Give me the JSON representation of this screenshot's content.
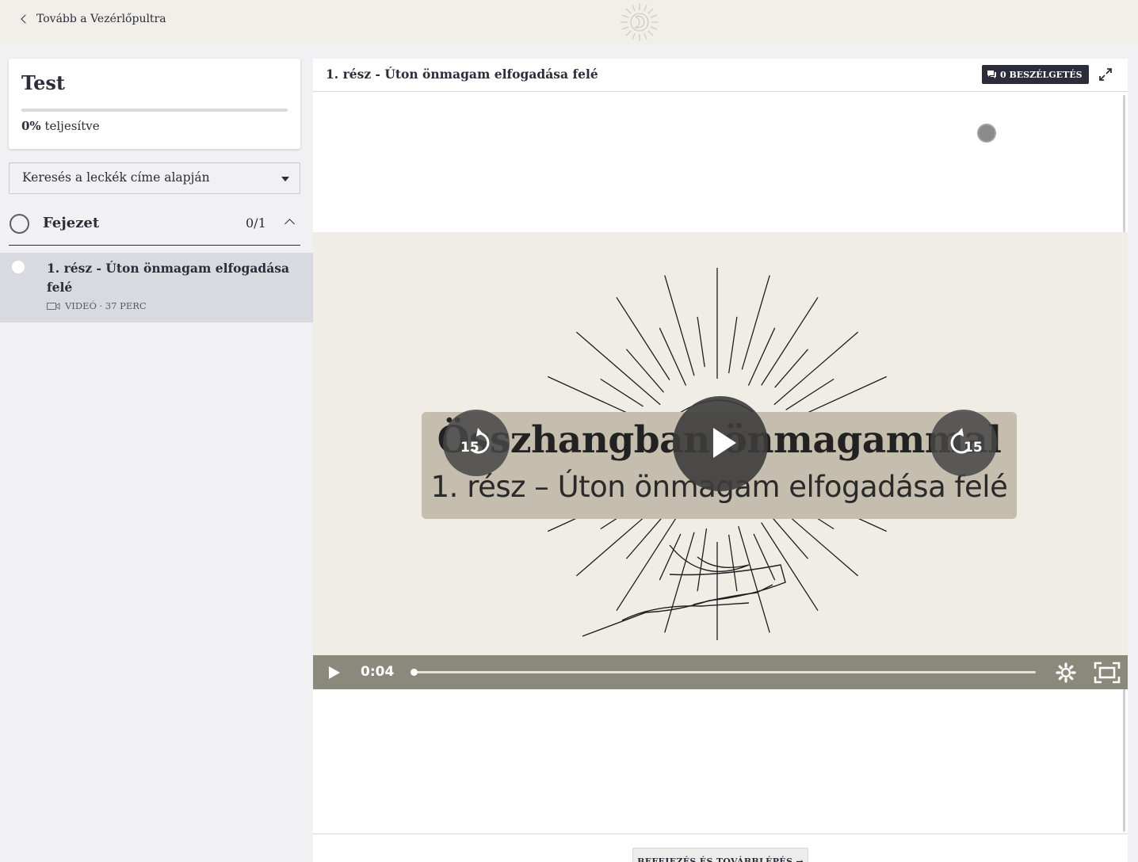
{
  "topbar": {
    "back_label": "Tovább a Vezérlőpultra",
    "logo_icon": "sun-moon-logo-icon"
  },
  "sidebar": {
    "course_title": "Test",
    "progress_percent": "0%",
    "progress_value": 0,
    "progress_suffix": "teljesítve",
    "search_placeholder": "Keresés a leckék címe alapján",
    "chapter": {
      "title": "Fejezet",
      "count": "0/1"
    },
    "lessons": [
      {
        "title": "1. rész - Úton önmagam elfogadása felé",
        "meta": "VIDEÓ · 37 PERC",
        "icon": "video-camera-icon"
      }
    ]
  },
  "content": {
    "lesson_heading": "1. rész - Úton önmagam elfogadása felé",
    "comments_label": "0 BESZÉLGETÉS",
    "video": {
      "title_text": "Összhangban önmagammal",
      "subtitle_text": "1. rész – Úton önmagam elfogadása felé",
      "skip_back": "15",
      "skip_forward": "15",
      "current_time": "0:04",
      "progress": 0.002
    },
    "finish_label": "BEFEJEZÉS ÉS TOVÁBBLÉPÉS →"
  },
  "colors": {
    "topbar_bg": "#f1efe9",
    "sidebar_bg": "#f1f1f3",
    "active_lesson_bg": "#d9dadf",
    "dark_text": "#2c2c3a",
    "video_bg": "#f0ede7",
    "video_band": "#c5bdad",
    "control_bar": "#8b897c"
  }
}
